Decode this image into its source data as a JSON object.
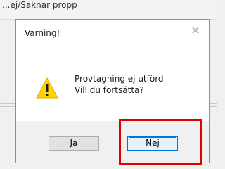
{
  "background": {
    "title": "...ej/Saknar propp"
  },
  "dialog": {
    "title": "Varning!",
    "close_glyph": "✕",
    "message_line1": "Provtagning ej utförd",
    "message_line2": "Vill du fortsätta?",
    "buttons": {
      "yes_label": "Ja",
      "no_label": "Nej"
    },
    "icon": "warning-icon"
  },
  "highlight_color": "#e00000"
}
